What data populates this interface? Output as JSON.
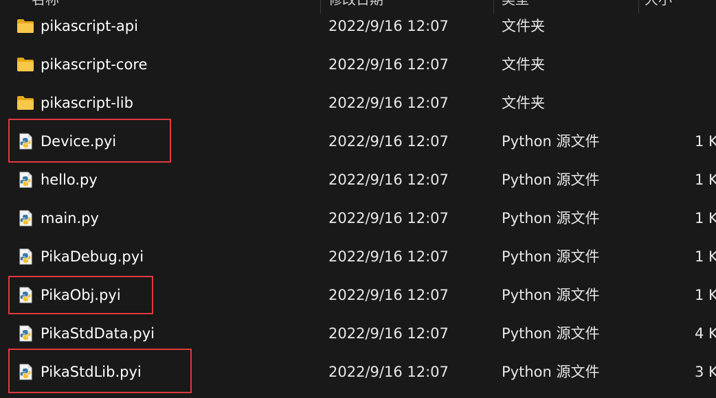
{
  "header": {
    "name_label": "名称",
    "date_label": "修改日期",
    "type_label": "类型",
    "size_label": "大小"
  },
  "colors": {
    "background": "#191919",
    "folder_icon": "#f5c242",
    "highlight_box": "#e0393e"
  },
  "files": [
    {
      "name": "pikascript-api",
      "date": "2022/9/16 12:07",
      "type": "文件夹",
      "size": "",
      "icon": "folder-icon",
      "highlighted": false
    },
    {
      "name": "pikascript-core",
      "date": "2022/9/16 12:07",
      "type": "文件夹",
      "size": "",
      "icon": "folder-icon",
      "highlighted": false
    },
    {
      "name": "pikascript-lib",
      "date": "2022/9/16 12:07",
      "type": "文件夹",
      "size": "",
      "icon": "folder-icon",
      "highlighted": false
    },
    {
      "name": "Device.pyi",
      "date": "2022/9/16 12:07",
      "type": "Python 源文件",
      "size": "1 K",
      "icon": "python-file-icon",
      "highlighted": true
    },
    {
      "name": "hello.py",
      "date": "2022/9/16 12:07",
      "type": "Python 源文件",
      "size": "1 K",
      "icon": "python-file-icon",
      "highlighted": false
    },
    {
      "name": "main.py",
      "date": "2022/9/16 12:07",
      "type": "Python 源文件",
      "size": "1 K",
      "icon": "python-file-icon",
      "highlighted": false
    },
    {
      "name": "PikaDebug.pyi",
      "date": "2022/9/16 12:07",
      "type": "Python 源文件",
      "size": "1 K",
      "icon": "python-file-icon",
      "highlighted": false
    },
    {
      "name": "PikaObj.pyi",
      "date": "2022/9/16 12:07",
      "type": "Python 源文件",
      "size": "1 K",
      "icon": "python-file-icon",
      "highlighted": true
    },
    {
      "name": "PikaStdData.pyi",
      "date": "2022/9/16 12:07",
      "type": "Python 源文件",
      "size": "4 K",
      "icon": "python-file-icon",
      "highlighted": false
    },
    {
      "name": "PikaStdLib.pyi",
      "date": "2022/9/16 12:07",
      "type": "Python 源文件",
      "size": "3 K",
      "icon": "python-file-icon",
      "highlighted": true
    }
  ]
}
